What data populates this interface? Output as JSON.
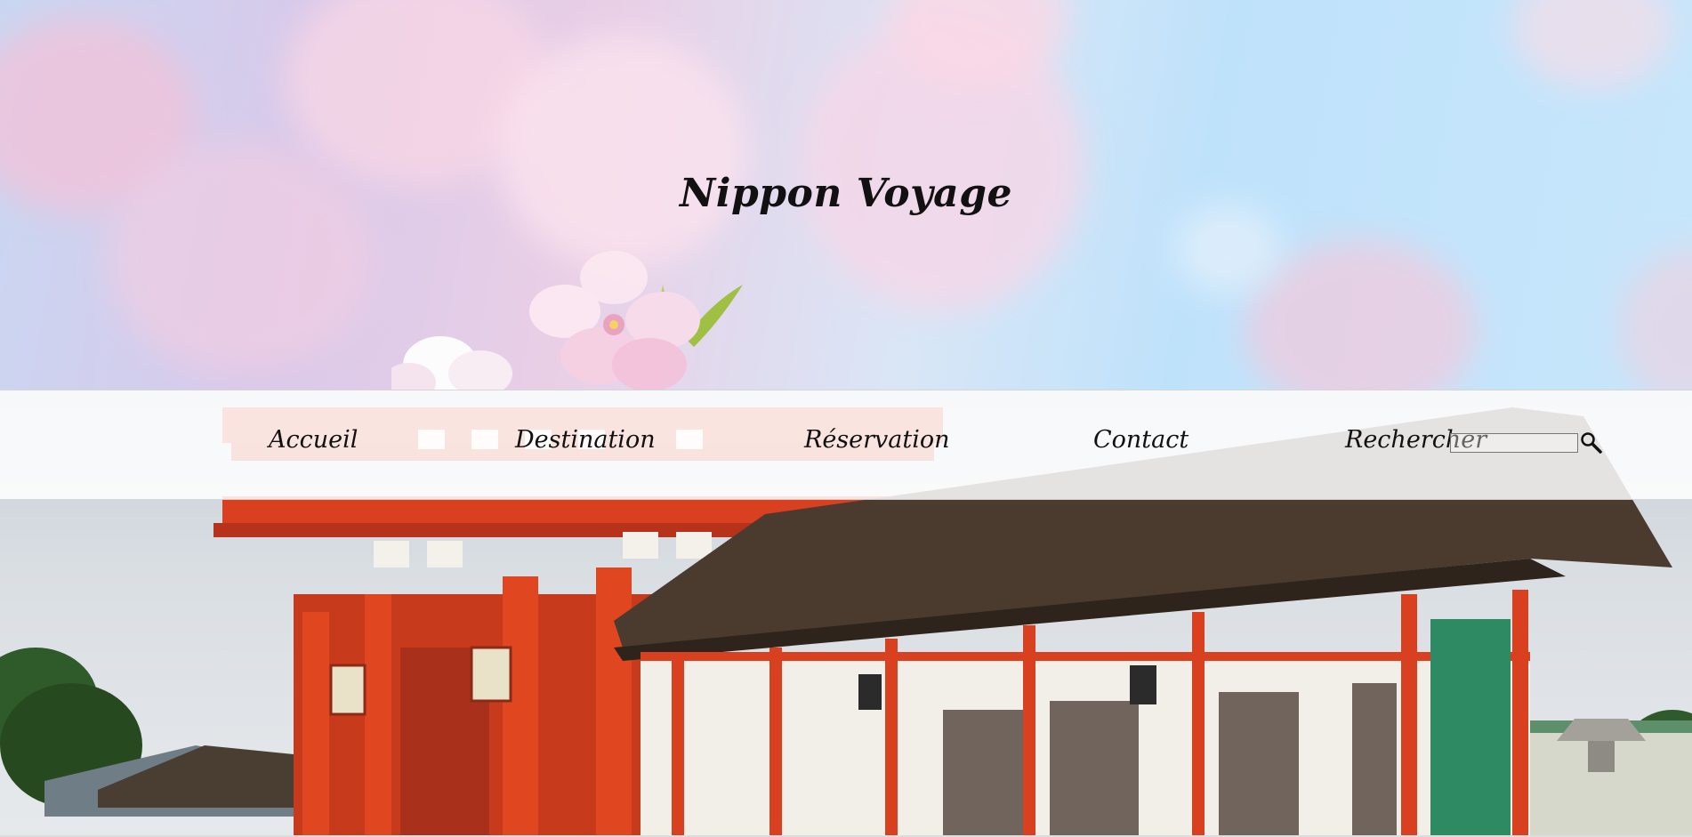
{
  "site": {
    "title": "Nippon Voyage"
  },
  "nav": {
    "items": [
      {
        "label": "Accueil"
      },
      {
        "label": "Destination"
      },
      {
        "label": "Réservation"
      },
      {
        "label": "Contact"
      }
    ],
    "search_label": "Rechercher",
    "search_placeholder": "",
    "search_icon": "magnifier-icon"
  },
  "colors": {
    "temple_red": "#d8401f",
    "roof_thatch": "#4a3b2e",
    "nav_bg": "#ffffff",
    "text": "#111111"
  }
}
